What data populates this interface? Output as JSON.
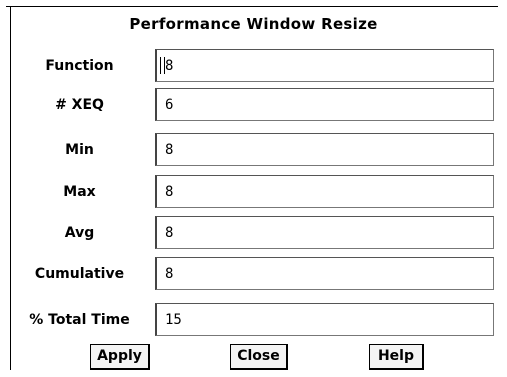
{
  "window": {
    "title": "Performance Window Resize"
  },
  "fields": [
    {
      "label": "Function",
      "value": "8"
    },
    {
      "label": "# XEQ",
      "value": "6"
    },
    {
      "label": "Min",
      "value": "8"
    },
    {
      "label": "Max",
      "value": "8"
    },
    {
      "label": "Avg",
      "value": "8"
    },
    {
      "label": "Cumulative",
      "value": "8"
    },
    {
      "label": "% Total Time",
      "value": "15"
    }
  ],
  "buttons": {
    "apply_label": "Apply",
    "close_label": "Close",
    "help_label": "Help"
  }
}
